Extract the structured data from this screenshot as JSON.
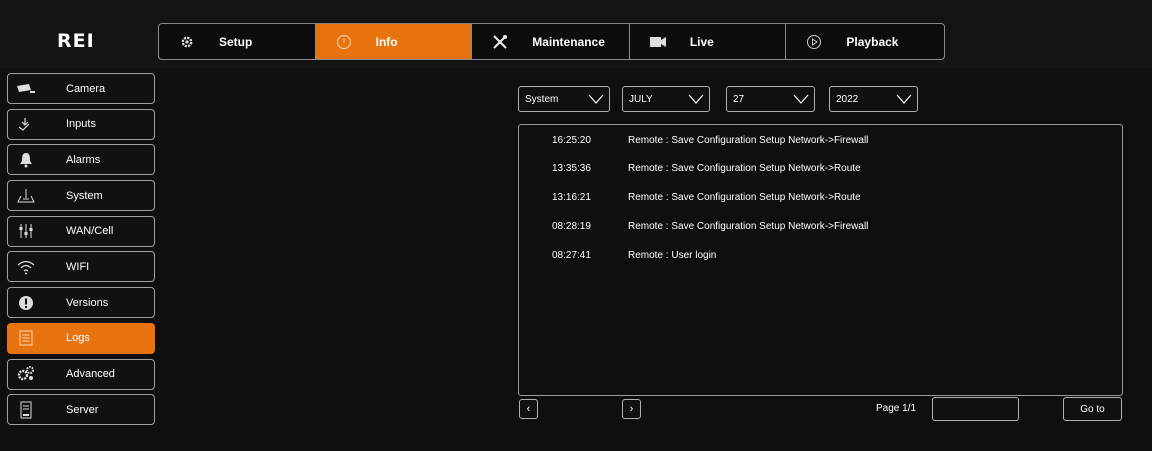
{
  "brand": {
    "logo": "REI",
    "accent": "#e8720e"
  },
  "topnav": {
    "tabs": [
      {
        "label": "Setup",
        "icon": "gear-icon"
      },
      {
        "label": "Info",
        "icon": "info-circle-icon",
        "active": true
      },
      {
        "label": "Maintenance",
        "icon": "tools-icon"
      },
      {
        "label": "Live",
        "icon": "video-camera-icon"
      },
      {
        "label": "Playback",
        "icon": "play-circle-icon"
      }
    ]
  },
  "sidebar": {
    "items": [
      {
        "label": "Camera",
        "icon": "camera-icon"
      },
      {
        "label": "Inputs",
        "icon": "inputs-icon"
      },
      {
        "label": "Alarms",
        "icon": "bell-icon"
      },
      {
        "label": "System",
        "icon": "system-icon"
      },
      {
        "label": "WAN/Cell",
        "icon": "sliders-icon"
      },
      {
        "label": "WIFI",
        "icon": "wifi-icon"
      },
      {
        "label": "Versions",
        "icon": "exclamation-icon"
      },
      {
        "label": "Logs",
        "icon": "logs-icon",
        "active": true
      },
      {
        "label": "Advanced",
        "icon": "gears-icon"
      },
      {
        "label": "Server",
        "icon": "server-icon"
      }
    ]
  },
  "filters": {
    "type": "System",
    "month": "JULY",
    "day": "27",
    "year": "2022"
  },
  "logs": [
    {
      "time": "16:25:20",
      "message": "Remote : Save Configuration Setup Network->Firewall"
    },
    {
      "time": "13:35:36",
      "message": "Remote : Save Configuration Setup Network->Route"
    },
    {
      "time": "13:16:21",
      "message": "Remote : Save Configuration Setup Network->Route"
    },
    {
      "time": "08:28:19",
      "message": "Remote : Save Configuration Setup Network->Firewall"
    },
    {
      "time": "08:27:41",
      "message": "Remote : User login"
    }
  ],
  "pagination": {
    "prev_label": "‹",
    "next_label": "›",
    "page_label": "Page 1/1",
    "page_input_value": "",
    "goto_label": "Go to"
  }
}
